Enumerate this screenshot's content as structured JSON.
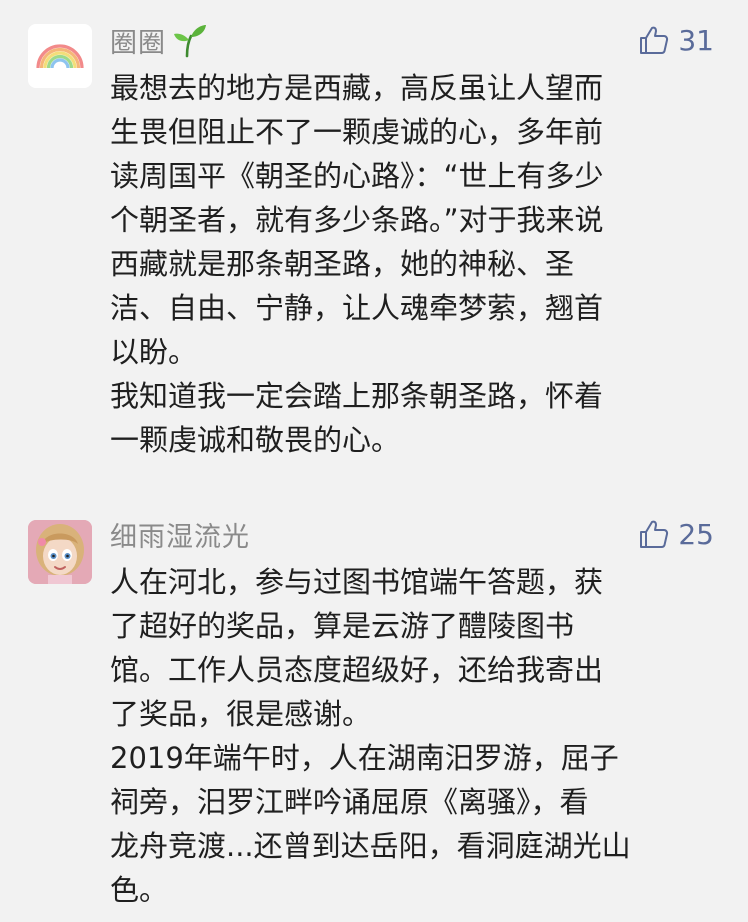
{
  "comments": [
    {
      "username": "圈圈",
      "likes": "31",
      "avatar_icon": "rainbow-icon",
      "name_decoration_icon": "sprout-icon",
      "paragraphs": [
        "最想去的地方是西藏，高反虽让人望而\n生畏但阻止不了一颗虔诚的心，多年前\n读周国平《朝圣的心路》：“世上有多少\n个朝圣者，就有多少条路。”对于我来说\n西藏就是那条朝圣路，她的神秘、圣\n洁、自由、宁静，让人魂牵梦萦，翘首\n以盼。",
        "我知道我一定会踏上那条朝圣路，怀着\n一颗虔诚和敬畏的心。"
      ]
    },
    {
      "username": "细雨湿流光",
      "likes": "25",
      "avatar_icon": "cartoon-girl-avatar",
      "paragraphs": [
        "人在河北，参与过图书馆端午答题，获\n了超好的奖品，算是云游了醴陵图书\n馆。工作人员态度超级好，还给我寄出\n了奖品，很是感谢。",
        "2019年端午时，人在湖南汨罗游，屈子\n祠旁，汨罗江畔吟诵屈原《离骚》，看\n龙舟竞渡...还曾到达岳阳，看洞庭湖光山\n色。"
      ]
    }
  ],
  "colors": {
    "background": "#f2f2f2",
    "username": "#8a8a8a",
    "like": "#5a6b9a",
    "text": "#1f1f1f"
  }
}
